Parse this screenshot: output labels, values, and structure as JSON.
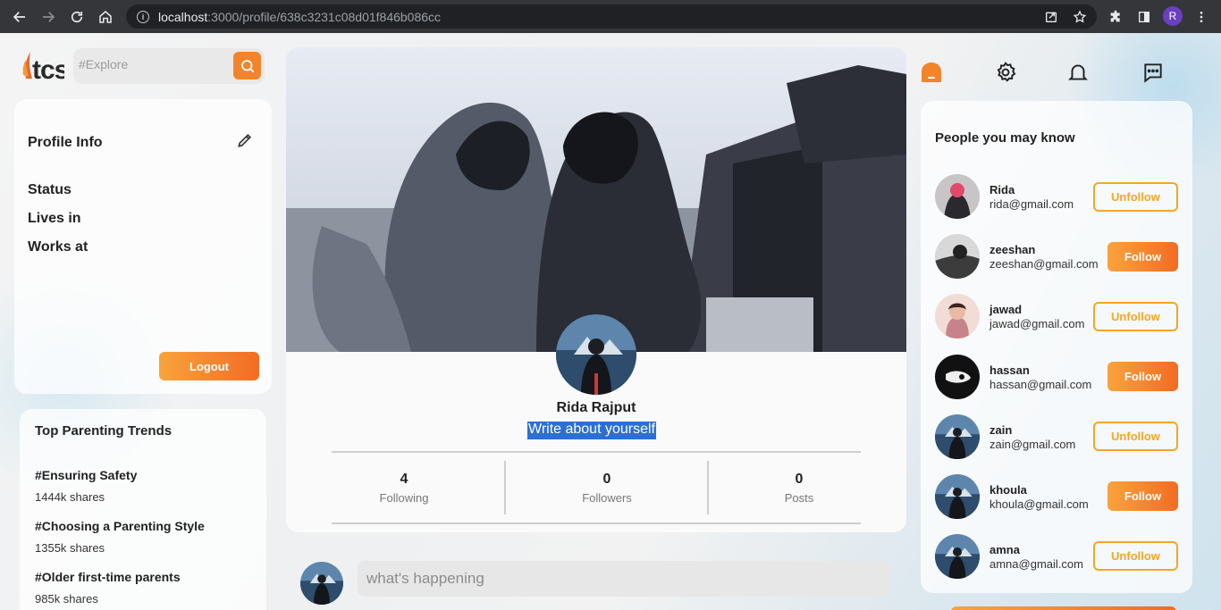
{
  "browser": {
    "url_host": "localhost",
    "url_path": ":3000/profile/638c3231c08d01f846b086cc",
    "profile_initial": "R"
  },
  "search": {
    "placeholder": "#Explore"
  },
  "profile_info": {
    "title": "Profile Info",
    "rows": [
      "Status",
      "Lives in",
      "Works at"
    ],
    "logout_label": "Logout"
  },
  "trends": {
    "title": "Top Parenting Trends",
    "items": [
      {
        "name": "#Ensuring Safety",
        "shares": "1444k shares"
      },
      {
        "name": "#Choosing a Parenting Style",
        "shares": "1355k shares"
      },
      {
        "name": "#Older first-time parents",
        "shares": "985k shares"
      }
    ]
  },
  "profile": {
    "name": "Rida Rajput",
    "bio": "Write about yourself",
    "stats": [
      {
        "value": "4",
        "label": "Following"
      },
      {
        "value": "0",
        "label": "Followers"
      },
      {
        "value": "0",
        "label": "Posts"
      }
    ]
  },
  "post": {
    "placeholder": "what's happening"
  },
  "people": {
    "title": "People you may know",
    "items": [
      {
        "name": "Rida",
        "email": "rida@gmail.com",
        "action": "Unfollow"
      },
      {
        "name": "zeeshan",
        "email": "zeeshan@gmail.com",
        "action": "Follow"
      },
      {
        "name": "jawad",
        "email": "jawad@gmail.com",
        "action": "Unfollow"
      },
      {
        "name": "hassan",
        "email": "hassan@gmail.com",
        "action": "Follow"
      },
      {
        "name": "zain",
        "email": "zain@gmail.com",
        "action": "Unfollow"
      },
      {
        "name": "khoula",
        "email": "khoula@gmail.com",
        "action": "Follow"
      },
      {
        "name": "amna",
        "email": "amna@gmail.com",
        "action": "Unfollow"
      }
    ]
  },
  "colors": {
    "accent": "#f2842b",
    "selection": "#2b6fd6",
    "chrome": "#35363a"
  }
}
